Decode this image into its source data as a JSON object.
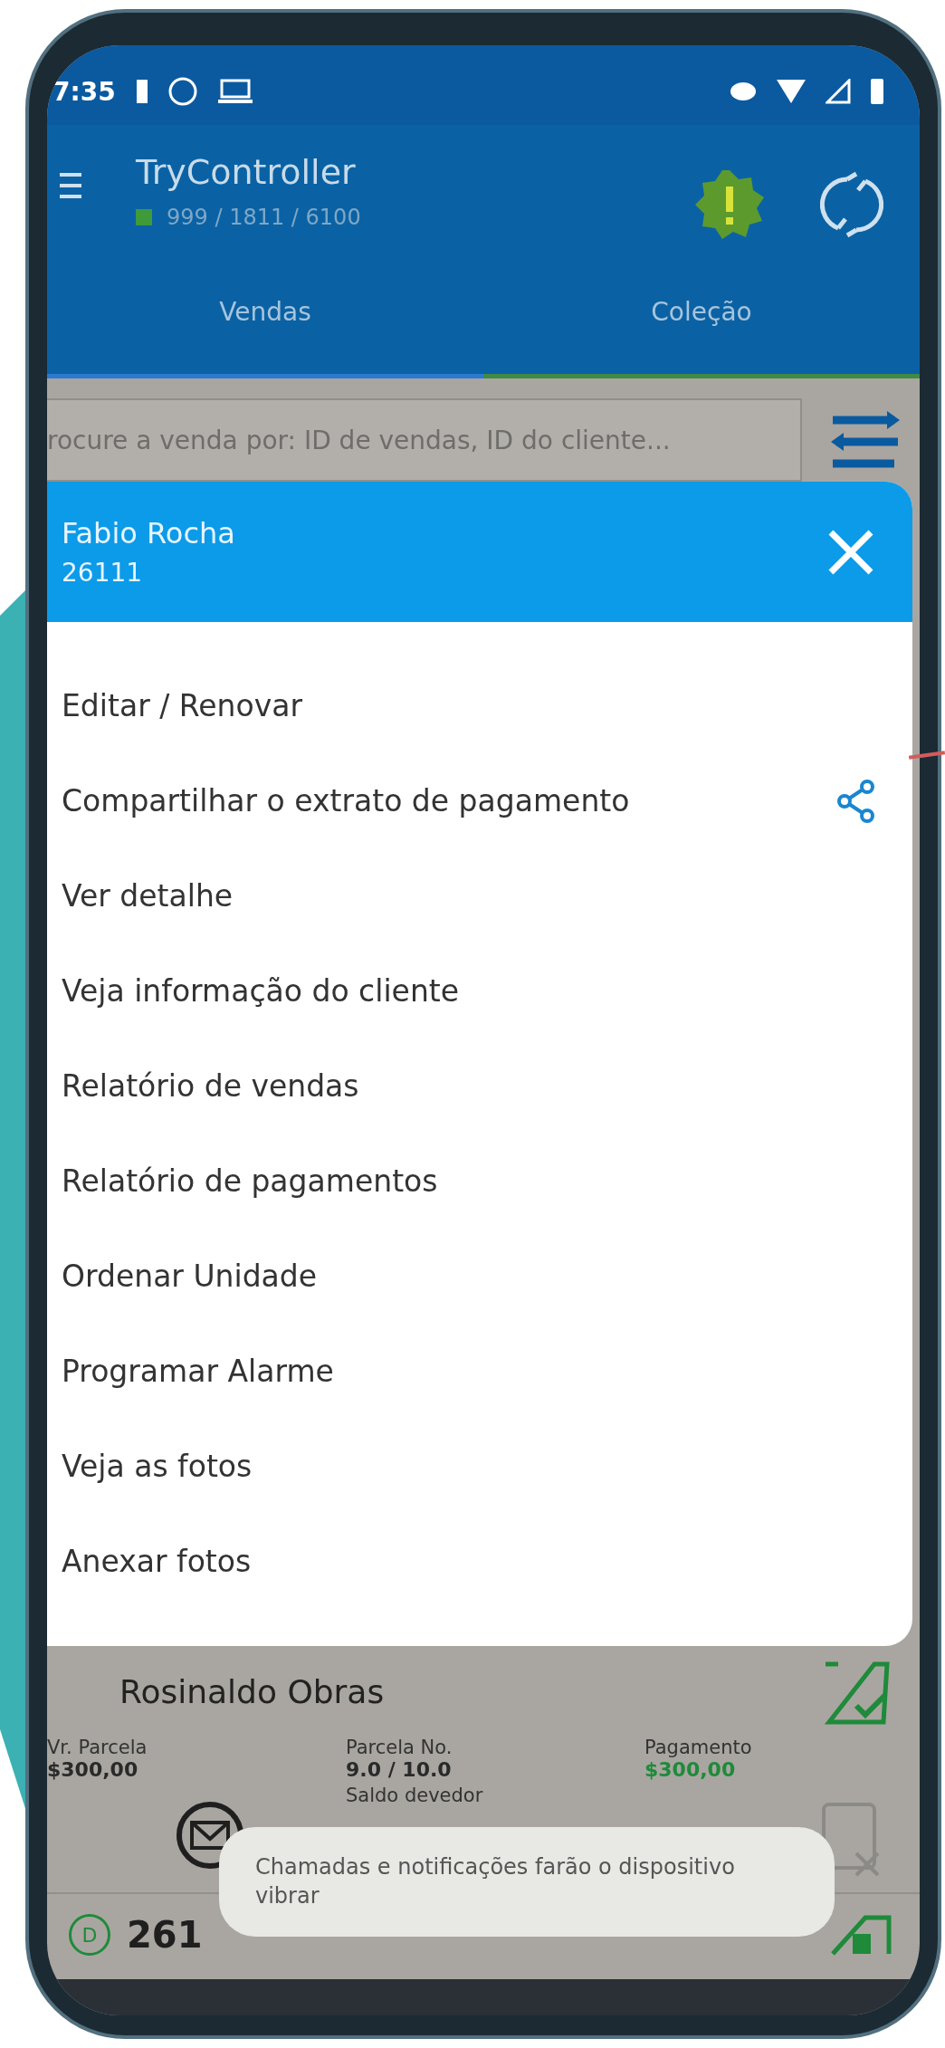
{
  "status_bar": {
    "time": "7:35"
  },
  "app_bar": {
    "title": "TryController",
    "subtitle": "999 / 1811 / 6100"
  },
  "tabs": [
    {
      "label": "Vendas",
      "selected": true
    },
    {
      "label": "Coleção",
      "selected": false
    }
  ],
  "search": {
    "placeholder": "rocure a venda por: ID de vendas, ID do cliente..."
  },
  "dialog": {
    "title": "Fabio Rocha",
    "subtitle": "26111",
    "items": [
      {
        "label": "Editar / Renovar",
        "share": false
      },
      {
        "label": "Compartilhar o extrato de pagamento",
        "share": true
      },
      {
        "label": "Ver detalhe",
        "share": false
      },
      {
        "label": "Veja informação do cliente",
        "share": false
      },
      {
        "label": "Relatório de vendas",
        "share": false
      },
      {
        "label": "Relatório de pagamentos",
        "share": false
      },
      {
        "label": "Ordenar Unidade",
        "share": false
      },
      {
        "label": "Programar Alarme",
        "share": false
      },
      {
        "label": "Veja as fotos",
        "share": false
      },
      {
        "label": "Anexar fotos",
        "share": false
      }
    ]
  },
  "card": {
    "name": "Rosinaldo Obras",
    "fields": [
      {
        "label": "Vr. Parcela",
        "value": "$300,00",
        "highlight": false
      },
      {
        "label": "Parcela No.",
        "value": "9.0 / 10.0",
        "highlight": false
      },
      {
        "label": "Pagamento",
        "value": "$300,00",
        "highlight": true
      }
    ],
    "balance_label": "Saldo devedor"
  },
  "next_row": {
    "badge": "D",
    "text": "261"
  },
  "toast": {
    "text": "Chamadas e notificações farão o dispositivo vibrar"
  }
}
